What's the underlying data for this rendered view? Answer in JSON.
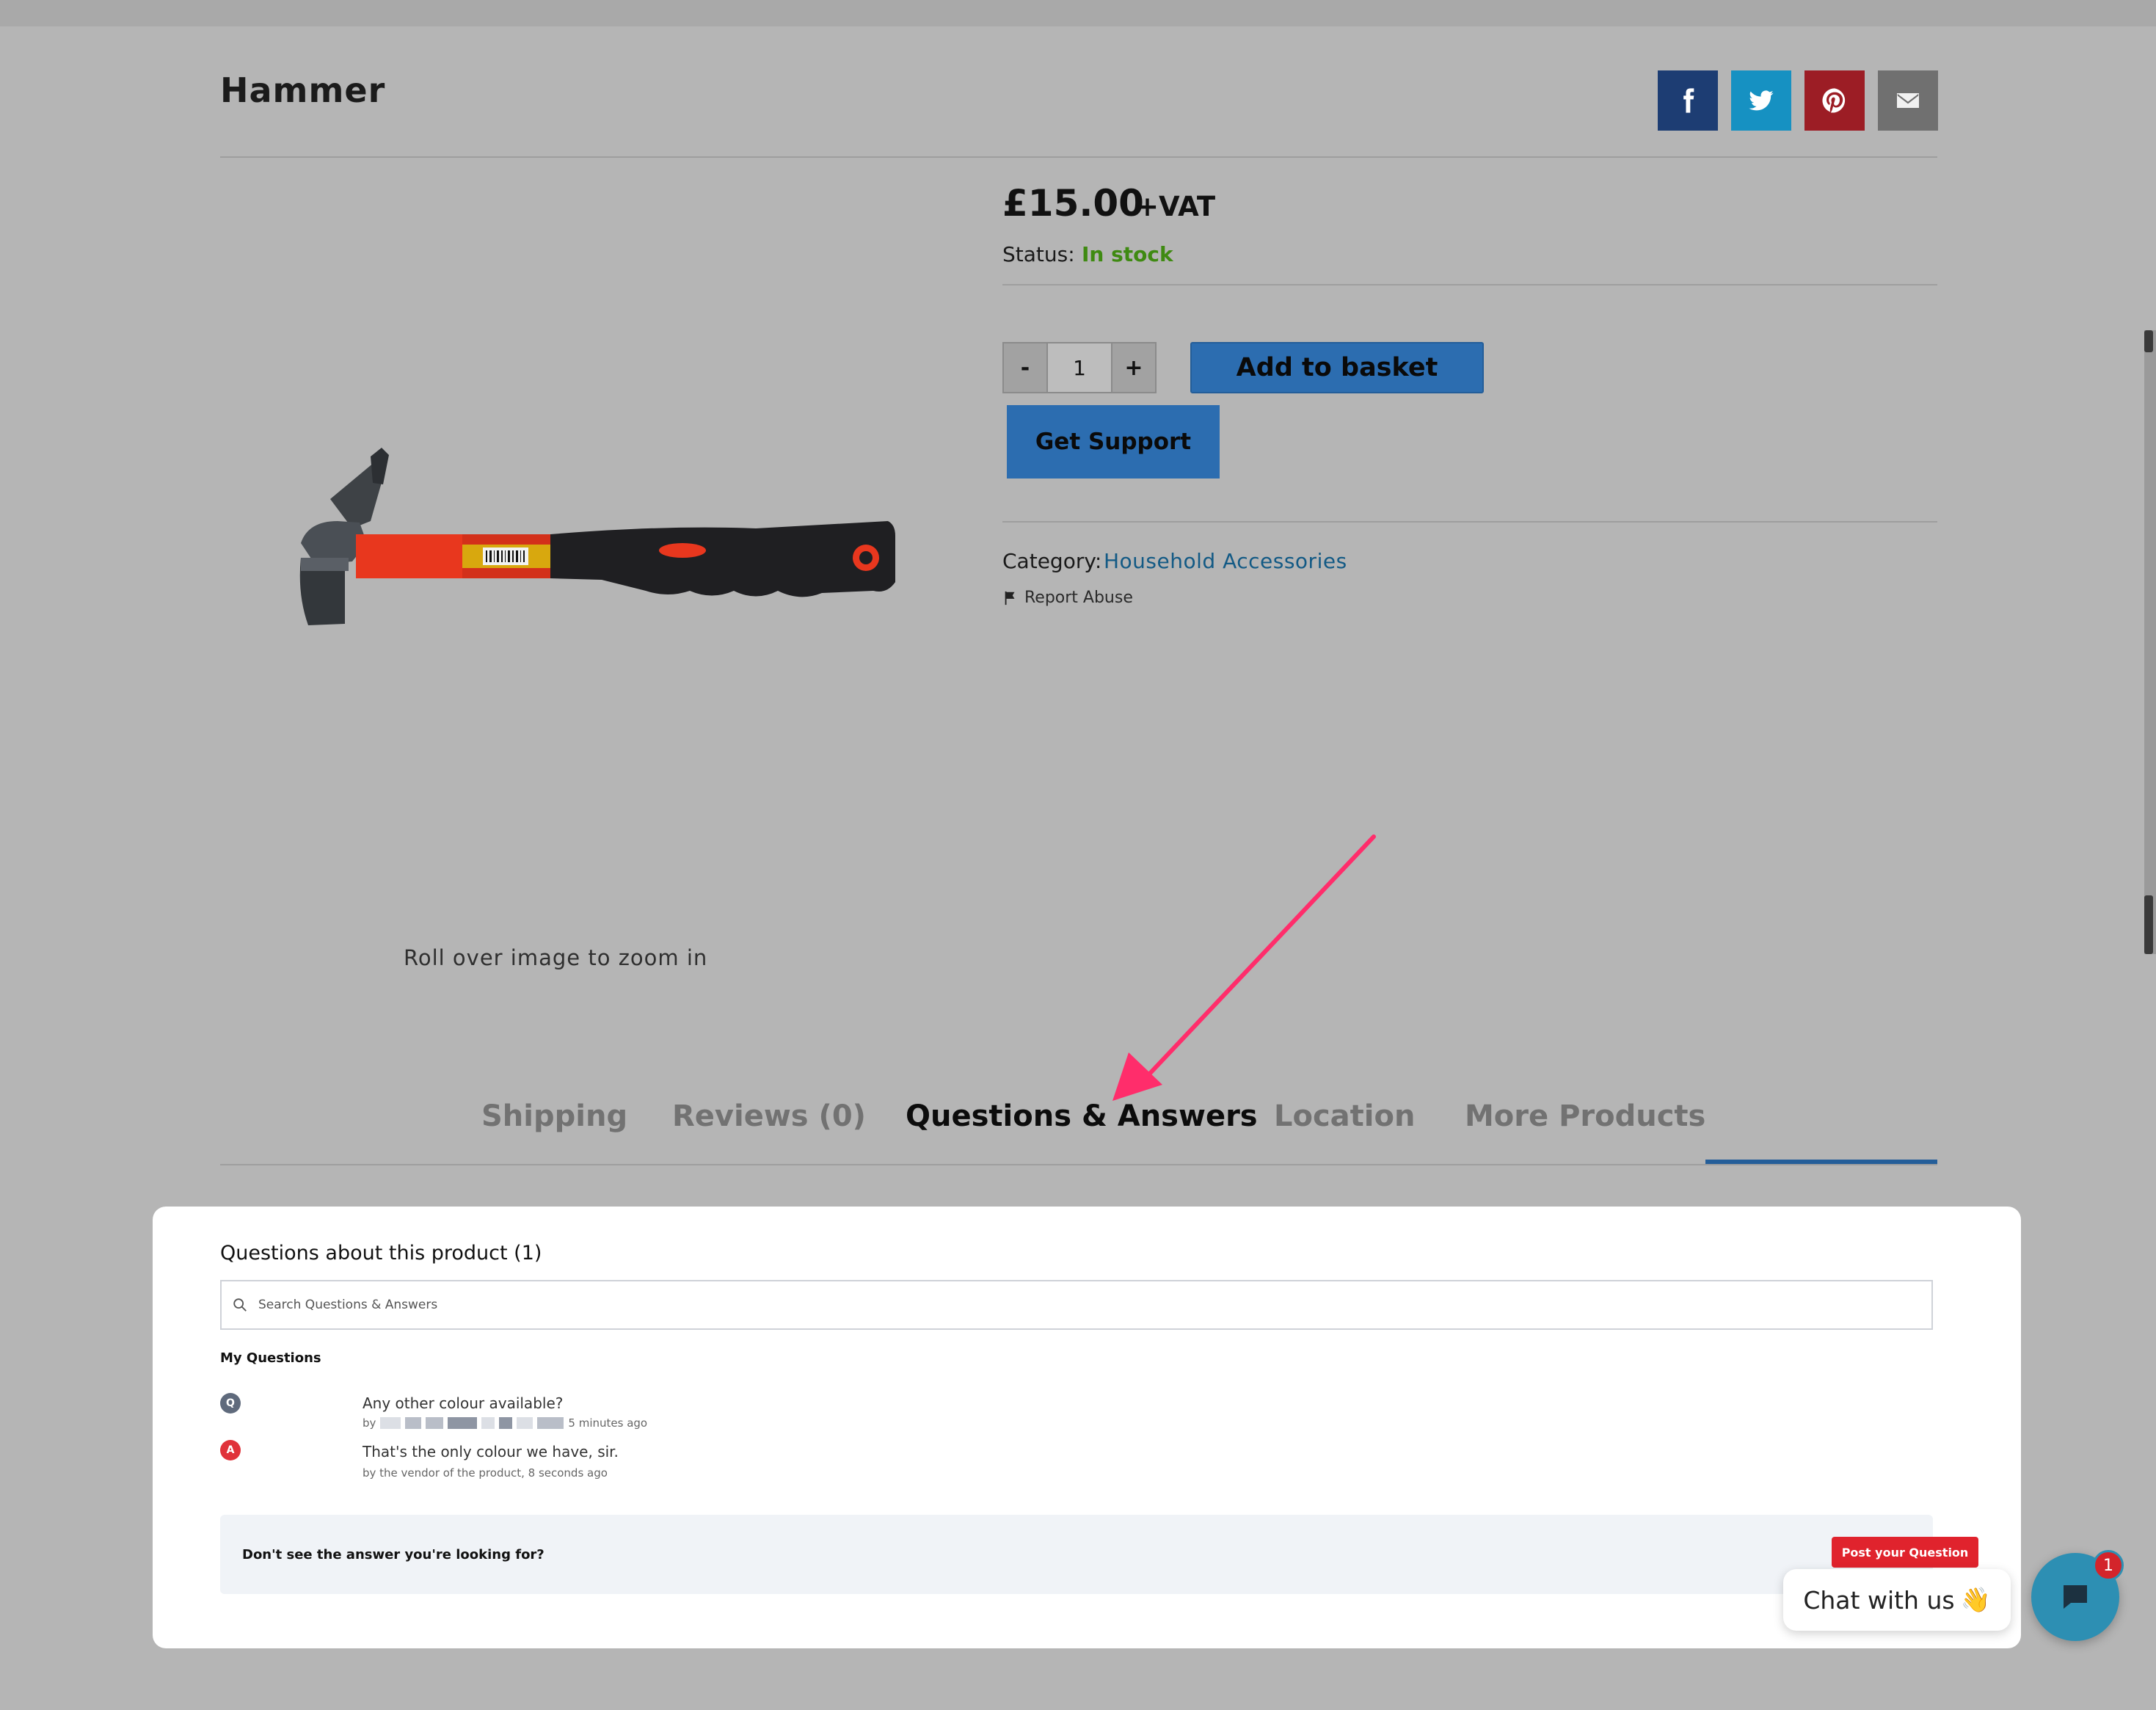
{
  "product": {
    "title": "Hammer",
    "price": "£15.00",
    "vat": "+VAT",
    "status_label": "Status:",
    "status_value": "In stock",
    "quantity": "1",
    "qty_minus": "-",
    "qty_plus": "+",
    "add_to_basket": "Add to basket",
    "get_support": "Get Support",
    "category_label": "Category:",
    "category_value": "Household Accessories",
    "report_abuse": "Report Abuse",
    "zoom_hint": "Roll over image to zoom in"
  },
  "share": {
    "icons": [
      "facebook-icon",
      "twitter-icon",
      "pinterest-icon",
      "email-icon"
    ]
  },
  "tabs": [
    {
      "label": "Shipping"
    },
    {
      "label": "Reviews (0)"
    },
    {
      "label": "Questions & Answers",
      "active": true
    },
    {
      "label": "Location"
    },
    {
      "label": "More Products"
    }
  ],
  "qa": {
    "title": "Questions about this product (1)",
    "search_placeholder": "Search Questions & Answers",
    "section": "My Questions",
    "question_badge": "Q",
    "answer_badge": "A",
    "question": "Any other colour available?",
    "question_by": "by",
    "question_time": "5 minutes ago",
    "answer": "That's the only colour we have, sir.",
    "answer_meta": "by the vendor of the product, 8 seconds ago",
    "footer_text": "Don't see the answer you're looking for?",
    "post_button": "Post your Question"
  },
  "chat": {
    "label": "Chat with us",
    "emoji": "👋",
    "badge_count": "1"
  },
  "colors": {
    "accent_blue": "#2c6db0",
    "in_stock_green": "#3f8a12",
    "link_blue": "#135a85",
    "annotation_arrow": "#ff2d6b",
    "post_button_red": "#e0232d",
    "chat_blue": "#2d8fb3"
  }
}
